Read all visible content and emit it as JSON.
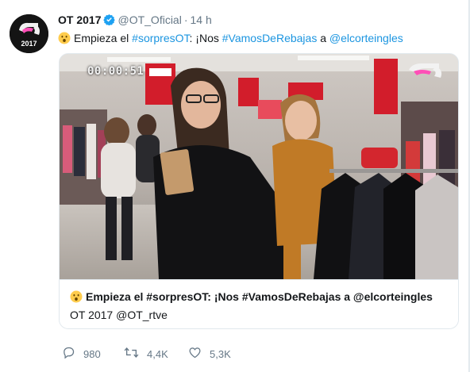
{
  "tweet": {
    "author_name": "OT 2017",
    "handle": "@OT_Oficial",
    "separator": "·",
    "time": "14 h",
    "avatar_text": "2017",
    "text": {
      "prefix": "Empieza el ",
      "hashtag1": "#sorpresOT",
      "middle": ": ¡Nos ",
      "hashtag2": "#VamosDeRebajas",
      "connector": " a ",
      "mention": "@elcorteingles"
    },
    "emoji": "astonished-face"
  },
  "card": {
    "video_timecode": "00:00:51",
    "title": "Empieza el #sorpresOT: ¡Nos #VamosDeRebajas a @elcorteingles",
    "source": "OT 2017 @OT_rtve"
  },
  "actions": {
    "reply_count": "980",
    "retweet_count": "4,4K",
    "like_count": "5,3K"
  },
  "colors": {
    "link": "#1b95e0",
    "muted": "#657786",
    "verified": "#1da1f2"
  }
}
